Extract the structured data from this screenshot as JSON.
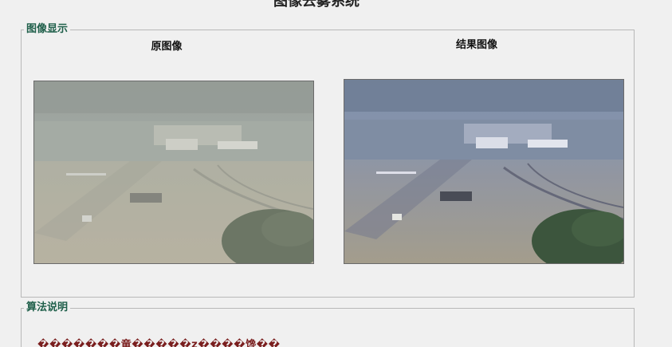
{
  "window": {
    "title": "图像去雾系统"
  },
  "display_group": {
    "legend": "图像显示",
    "original_caption": "原图像",
    "result_caption": "结果图像",
    "original_image_icon": "hazy-landscape-photo",
    "result_image_icon": "dehazed-landscape-photo"
  },
  "algorithm_group": {
    "legend": "算法说明",
    "description": "�������竜�����z����馋��"
  },
  "colors": {
    "background": "#f0f0f0",
    "legend_text": "#1f5f4a",
    "description_text": "#7a1e1e"
  }
}
